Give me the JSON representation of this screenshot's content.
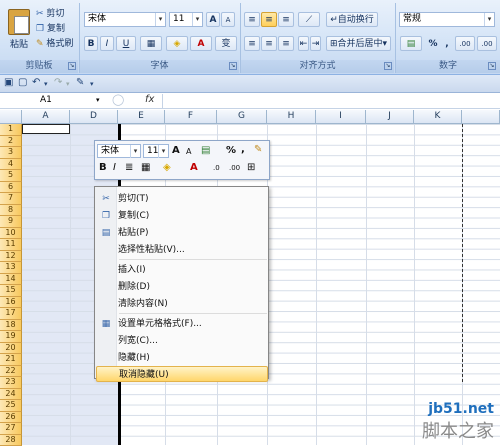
{
  "ribbon": {
    "clipboard": {
      "paste": "粘贴",
      "cut": "剪切",
      "copy": "复制",
      "format_painter": "格式刷",
      "group": "剪贴板"
    },
    "font": {
      "name": "宋体",
      "size": "11",
      "bold": "B",
      "italic": "I",
      "underline": "U",
      "grow": "A",
      "shrink": "A",
      "wen": "变",
      "color_a": "A",
      "group": "字体"
    },
    "alignment": {
      "wrap": "自动换行",
      "merge": "合并后居中",
      "group": "对齐方式"
    },
    "number": {
      "format": "常规",
      "percent": "%",
      "comma": ",",
      "inc_dec": ".00",
      "dec_dec": ".00",
      "group": "数字"
    }
  },
  "formula_bar": {
    "name_box": "A1",
    "fx": "fx"
  },
  "columns": [
    "A",
    "D",
    "E",
    "F",
    "G",
    "H",
    "I",
    "J",
    "K"
  ],
  "rows": [
    "1",
    "2",
    "3",
    "4",
    "5",
    "6",
    "7",
    "8",
    "9",
    "10",
    "11",
    "12",
    "13",
    "14",
    "15",
    "16",
    "17",
    "18",
    "19",
    "20",
    "21",
    "22",
    "23",
    "24",
    "25",
    "26",
    "27",
    "28"
  ],
  "mini_toolbar": {
    "font": "宋体",
    "size": "11",
    "grow": "A",
    "shrink": "A",
    "percent": "%",
    "comma": ",",
    "bold": "B",
    "italic": "I",
    "color_a": "A",
    "dec1": ".0",
    "dec2": ".00"
  },
  "context_menu": {
    "items": [
      {
        "label": "剪切(T)",
        "icon": "scissors-icon"
      },
      {
        "label": "复制(C)",
        "icon": "copy-icon"
      },
      {
        "label": "粘贴(P)",
        "icon": "paste-icon"
      },
      {
        "label": "选择性粘贴(V)...",
        "icon": ""
      },
      {
        "label": "插入(I)",
        "icon": ""
      },
      {
        "label": "删除(D)",
        "icon": ""
      },
      {
        "label": "清除内容(N)",
        "icon": ""
      },
      {
        "label": "设置单元格格式(F)...",
        "icon": "format-cells-icon"
      },
      {
        "label": "列宽(C)...",
        "icon": ""
      },
      {
        "label": "隐藏(H)",
        "icon": ""
      },
      {
        "label": "取消隐藏(U)",
        "icon": ""
      }
    ]
  },
  "watermark": {
    "site": "jb51.net",
    "brand": "脚本之家"
  }
}
